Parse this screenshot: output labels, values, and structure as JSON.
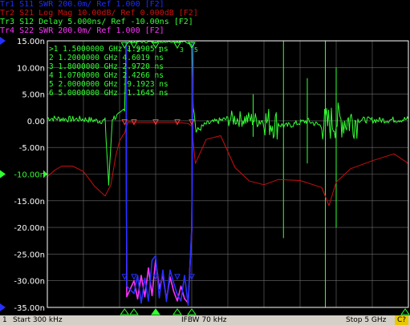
{
  "traces": [
    {
      "label": "Tr1 S11 SWR 200.0m/ Ref 1.000 [F2]",
      "color": "#1f2cff",
      "active": false
    },
    {
      "label": "Tr2 S21 Log Mag 10.00dB/ Ref 0.000dB [F2]",
      "color": "#d01010",
      "active": false
    },
    {
      "label": "Tr3 S12 Delay 5.000ns/ Ref -10.00ns [F2]",
      "color": "#33ff33",
      "active": true
    },
    {
      "label": "Tr4 S22 SWR 200.0m/ Ref 1.000 [F2]",
      "color": "#ff33ff",
      "active": false
    }
  ],
  "markers": [
    {
      "row": ">1  1.5000000 GHz  1.9905 ns"
    },
    {
      "row": " 2  1.2000000 GHz  4.6019 ns"
    },
    {
      "row": " 3  1.8000000 GHz  2.9720 ns"
    },
    {
      "row": " 4  1.0700000 GHz  2.4266 ns"
    },
    {
      "row": " 5  2.0000000 GHz -9.1923 ns"
    },
    {
      "row": " 6  5.0000000 GHz -1.1645 ns"
    }
  ],
  "status": {
    "channel": "1",
    "start": "Start 300 kHz",
    "ifbw": "IFBW 70 kHz",
    "stop": "Stop 5 GHz",
    "cal": "C?"
  },
  "chart_data": {
    "type": "line",
    "xlabel": "",
    "ylabel": "",
    "xlim": [
      0.0003,
      5.0
    ],
    "ylim": [
      -35,
      15
    ],
    "yticks": [
      15,
      10,
      5,
      0,
      -5,
      -10,
      -15,
      -20,
      -25,
      -30,
      -35
    ],
    "ytick_labels": [
      "15.00n",
      "10.00n",
      "5.00n",
      "0.00",
      "-5.00n",
      "-10.00n",
      "-15.00n",
      "-20.00n",
      "-25.00n",
      "-30.00n",
      "-35.00n"
    ],
    "ref_level": -10,
    "grid": true,
    "series": [
      {
        "name": "Tr3 S12 Delay",
        "color": "#33ff33",
        "x": [
          0.0003,
          0.3,
          0.5,
          0.7,
          0.8,
          0.85,
          0.9,
          1.0,
          1.07,
          1.09,
          1.15,
          1.3,
          1.5,
          1.7,
          1.9,
          2.0,
          2.02,
          2.06,
          2.2,
          2.5,
          2.8,
          3.0,
          3.3,
          3.6,
          3.8,
          4.0,
          4.3,
          4.6,
          5.0
        ],
        "y": [
          0.5,
          0.3,
          0.3,
          0.0,
          0.0,
          -12,
          0.5,
          1.0,
          2.4,
          14.5,
          14.8,
          14.8,
          14.8,
          14.9,
          14.8,
          14.5,
          3.0,
          -2.0,
          -0.6,
          0.4,
          0.3,
          0.0,
          -1.0,
          0.0,
          -1.0,
          0.0,
          0.2,
          0.1,
          0.3
        ]
      },
      {
        "name": "Tr2 S21 Log Mag",
        "color": "#c81010",
        "x": [
          0.0003,
          0.1,
          0.2,
          0.35,
          0.5,
          0.65,
          0.8,
          0.88,
          0.95,
          1.0,
          1.05,
          1.07,
          1.09,
          1.12,
          1.2,
          1.5,
          1.8,
          1.95,
          2.0,
          2.02,
          2.05,
          2.2,
          2.4,
          2.6,
          2.8,
          3.0,
          3.2,
          3.5,
          3.8,
          3.9,
          4.0,
          4.2,
          4.5,
          4.8,
          5.0
        ],
        "y": [
          -10.5,
          -9.3,
          -8.5,
          -8.5,
          -9.5,
          -12.2,
          -14.1,
          -12.0,
          -6.4,
          -3.8,
          -2.6,
          -2.4,
          -1.2,
          -0.2,
          -0.3,
          -0.3,
          -0.3,
          -0.5,
          -1.0,
          -4.0,
          -8.0,
          -3.5,
          -2.8,
          -8.8,
          -11.3,
          -12.0,
          -11.0,
          -11.2,
          -12.5,
          -15.9,
          -11.5,
          -9.0,
          -7.5,
          -6.2,
          -8.0
        ]
      },
      {
        "name": "Tr1 S11 SWR",
        "color": "#2530ff",
        "x": [
          1.09,
          1.1,
          1.2,
          1.25,
          1.3,
          1.35,
          1.4,
          1.45,
          1.5,
          1.55,
          1.6,
          1.65,
          1.7,
          1.75,
          1.8,
          1.85,
          1.9,
          1.95,
          2.0,
          2.02
        ],
        "y": [
          14.8,
          -31.0,
          -32.4,
          -29.0,
          -34.2,
          -29.5,
          -33.8,
          -26.2,
          -25.3,
          -33.2,
          -28.0,
          -33.9,
          -28.0,
          -30.4,
          -32.6,
          -33.8,
          -29.0,
          -34.6,
          -20.0,
          14.8
        ]
      },
      {
        "name": "Tr4 S22 SWR",
        "color": "#ff33ff",
        "x": [
          1.09,
          1.1,
          1.2,
          1.25,
          1.3,
          1.35,
          1.4,
          1.45,
          1.5,
          1.55,
          1.6,
          1.65,
          1.7,
          1.75,
          1.8,
          1.85,
          1.9,
          1.95,
          2.0,
          2.02
        ],
        "y": [
          14.8,
          -33.0,
          -30.0,
          -33.4,
          -29.0,
          -33.0,
          -27.6,
          -32.8,
          -26.0,
          -31.5,
          -29.0,
          -33.5,
          -29.3,
          -32.0,
          -33.8,
          -31.0,
          -33.4,
          -34.2,
          -20.5,
          14.8
        ]
      }
    ],
    "marker_x": [
      1.5,
      1.2,
      1.8,
      1.07,
      2.0,
      5.0
    ],
    "marker_labels": [
      "1",
      "2",
      "3",
      "4",
      "5",
      "6"
    ]
  },
  "ui_colors": {
    "grid": "#6e6e6e",
    "frame": "#ffffff",
    "background": "#000000"
  }
}
